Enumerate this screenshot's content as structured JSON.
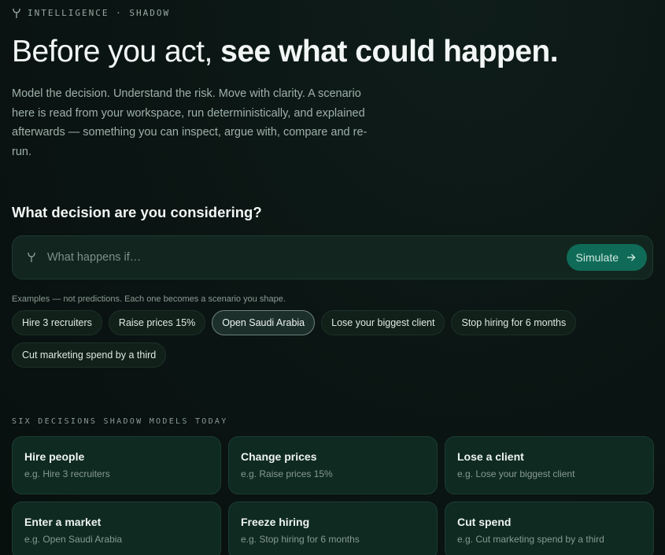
{
  "header": {
    "eyebrow": "INTELLIGENCE · SHADOW",
    "brand_icon": "tuning-fork-icon"
  },
  "hero": {
    "headline_light": "Before you act,",
    "headline_bold": "see what could happen.",
    "lede": "Model the decision. Understand the risk. Move with clarity. A scenario here is read from your workspace, run deterministically, and explained afterwards — something you can inspect, argue with, compare and re-run."
  },
  "prompt": {
    "question": "What decision are you considering?",
    "input_value": "",
    "input_placeholder": "What happens if…",
    "simulate_label": "Simulate",
    "simulate_icon": "arrow-right-icon"
  },
  "examples": {
    "note": "Examples — not predictions. Each one becomes a scenario you shape.",
    "chips": [
      {
        "label": "Hire 3 recruiters",
        "active": false
      },
      {
        "label": "Raise prices 15%",
        "active": false
      },
      {
        "label": "Open Saudi Arabia",
        "active": true
      },
      {
        "label": "Lose your biggest client",
        "active": false
      },
      {
        "label": "Stop hiring for 6 months",
        "active": false
      },
      {
        "label": "Cut marketing spend by a third",
        "active": false
      }
    ]
  },
  "decisions": {
    "section_label": "SIX DECISIONS SHADOW MODELS TODAY",
    "cards": [
      {
        "title": "Hire people",
        "example": "e.g. Hire 3 recruiters"
      },
      {
        "title": "Change prices",
        "example": "e.g. Raise prices 15%"
      },
      {
        "title": "Lose a client",
        "example": "e.g. Lose your biggest client"
      },
      {
        "title": "Enter a market",
        "example": "e.g. Open Saudi Arabia"
      },
      {
        "title": "Freeze hiring",
        "example": "e.g. Stop hiring for 6 months"
      },
      {
        "title": "Cut spend",
        "example": "e.g. Cut marketing spend by a third"
      }
    ]
  },
  "colors": {
    "background": "#0a1412",
    "accent": "#0f6b58",
    "card": "#0f2a21"
  }
}
